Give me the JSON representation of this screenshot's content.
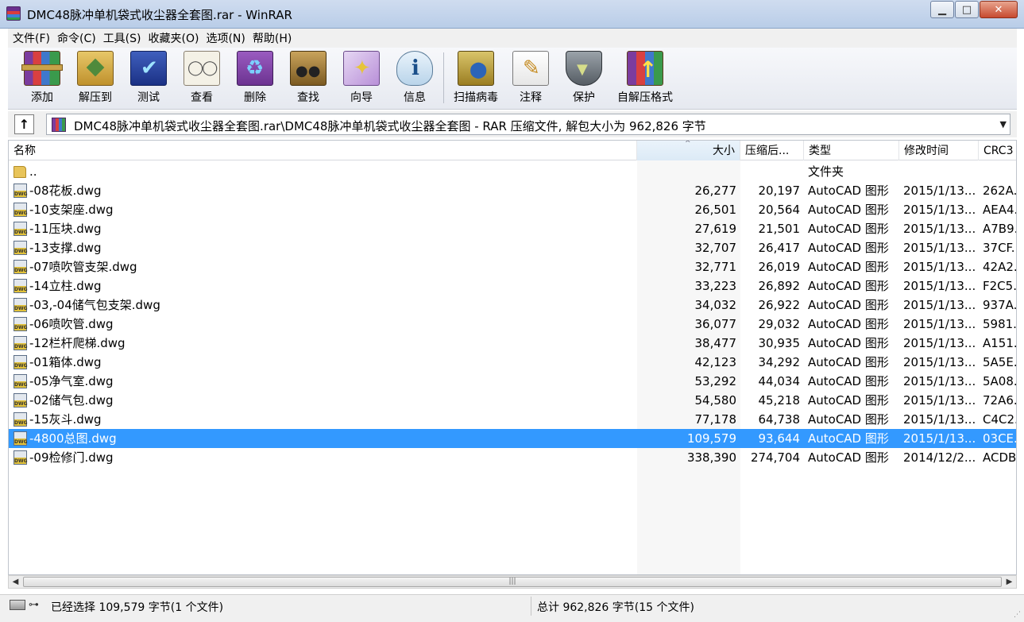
{
  "window": {
    "title": "DMC48脉冲单机袋式收尘器全套图.rar - WinRAR",
    "minimize": "▁",
    "maximize": "□",
    "close": "✕"
  },
  "menu": [
    "文件(F)",
    "命令(C)",
    "工具(S)",
    "收藏夹(O)",
    "选项(N)",
    "帮助(H)"
  ],
  "toolbar": [
    {
      "label": "添加",
      "icon": "add-archive-icon"
    },
    {
      "label": "解压到",
      "icon": "extract-to-icon"
    },
    {
      "label": "测试",
      "icon": "test-icon"
    },
    {
      "label": "查看",
      "icon": "view-icon"
    },
    {
      "label": "删除",
      "icon": "delete-icon"
    },
    {
      "label": "查找",
      "icon": "find-icon"
    },
    {
      "label": "向导",
      "icon": "wizard-icon"
    },
    {
      "label": "信息",
      "icon": "info-icon"
    },
    {
      "label": "扫描病毒",
      "icon": "virus-scan-icon"
    },
    {
      "label": "注释",
      "icon": "comment-icon"
    },
    {
      "label": "保护",
      "icon": "protect-icon"
    },
    {
      "label": "自解压格式",
      "icon": "sfx-icon"
    }
  ],
  "address": {
    "up_icon": "↑",
    "path": "DMC48脉冲单机袋式收尘器全套图.rar\\DMC48脉冲单机袋式收尘器全套图 - RAR 压缩文件, 解包大小为 962,826 字节",
    "dropdown": "▼"
  },
  "columns": {
    "name": "名称",
    "size": "大小",
    "packed": "压缩后...",
    "type": "类型",
    "modified": "修改时间",
    "crc": "CRC3",
    "sort_indicator": "^"
  },
  "files": [
    {
      "name": "..",
      "size": "",
      "packed": "",
      "type": "文件夹",
      "modified": "",
      "crc": "",
      "icon": "folder"
    },
    {
      "name": "-08花板.dwg",
      "size": "26,277",
      "packed": "20,197",
      "type": "AutoCAD 图形",
      "modified": "2015/1/13...",
      "crc": "262A...",
      "icon": "dwg"
    },
    {
      "name": "-10支架座.dwg",
      "size": "26,501",
      "packed": "20,564",
      "type": "AutoCAD 图形",
      "modified": "2015/1/13...",
      "crc": "AEA4...",
      "icon": "dwg"
    },
    {
      "name": "-11压块.dwg",
      "size": "27,619",
      "packed": "21,501",
      "type": "AutoCAD 图形",
      "modified": "2015/1/13...",
      "crc": "A7B9...",
      "icon": "dwg"
    },
    {
      "name": "-13支撑.dwg",
      "size": "32,707",
      "packed": "26,417",
      "type": "AutoCAD 图形",
      "modified": "2015/1/13...",
      "crc": "37CF...",
      "icon": "dwg"
    },
    {
      "name": "-07喷吹管支架.dwg",
      "size": "32,771",
      "packed": "26,019",
      "type": "AutoCAD 图形",
      "modified": "2015/1/13...",
      "crc": "42A2...",
      "icon": "dwg"
    },
    {
      "name": "-14立柱.dwg",
      "size": "33,223",
      "packed": "26,892",
      "type": "AutoCAD 图形",
      "modified": "2015/1/13...",
      "crc": "F2C5...",
      "icon": "dwg"
    },
    {
      "name": "-03,-04储气包支架.dwg",
      "size": "34,032",
      "packed": "26,922",
      "type": "AutoCAD 图形",
      "modified": "2015/1/13...",
      "crc": "937A...",
      "icon": "dwg"
    },
    {
      "name": "-06喷吹管.dwg",
      "size": "36,077",
      "packed": "29,032",
      "type": "AutoCAD 图形",
      "modified": "2015/1/13...",
      "crc": "5981...",
      "icon": "dwg"
    },
    {
      "name": "-12栏杆爬梯.dwg",
      "size": "38,477",
      "packed": "30,935",
      "type": "AutoCAD 图形",
      "modified": "2015/1/13...",
      "crc": "A151...",
      "icon": "dwg"
    },
    {
      "name": "-01箱体.dwg",
      "size": "42,123",
      "packed": "34,292",
      "type": "AutoCAD 图形",
      "modified": "2015/1/13...",
      "crc": "5A5E...",
      "icon": "dwg"
    },
    {
      "name": "-05净气室.dwg",
      "size": "53,292",
      "packed": "44,034",
      "type": "AutoCAD 图形",
      "modified": "2015/1/13...",
      "crc": "5A08...",
      "icon": "dwg"
    },
    {
      "name": "-02储气包.dwg",
      "size": "54,580",
      "packed": "45,218",
      "type": "AutoCAD 图形",
      "modified": "2015/1/13...",
      "crc": "72A6...",
      "icon": "dwg"
    },
    {
      "name": "-15灰斗.dwg",
      "size": "77,178",
      "packed": "64,738",
      "type": "AutoCAD 图形",
      "modified": "2015/1/13...",
      "crc": "C4C2...",
      "icon": "dwg"
    },
    {
      "name": "-4800总图.dwg",
      "size": "109,579",
      "packed": "93,644",
      "type": "AutoCAD 图形",
      "modified": "2015/1/13...",
      "crc": "03CE...",
      "icon": "dwg",
      "selected": true
    },
    {
      "name": "-09检修门.dwg",
      "size": "338,390",
      "packed": "274,704",
      "type": "AutoCAD 图形",
      "modified": "2014/12/2...",
      "crc": "ACDB...",
      "icon": "dwg"
    }
  ],
  "scrollbar": {
    "left": "◀",
    "right": "▶",
    "grip": "|||"
  },
  "status": {
    "selected": "已经选择 109,579 字节(1 个文件)",
    "total": "总计 962,826 字节(15 个文件)",
    "icon2": "⊶"
  }
}
